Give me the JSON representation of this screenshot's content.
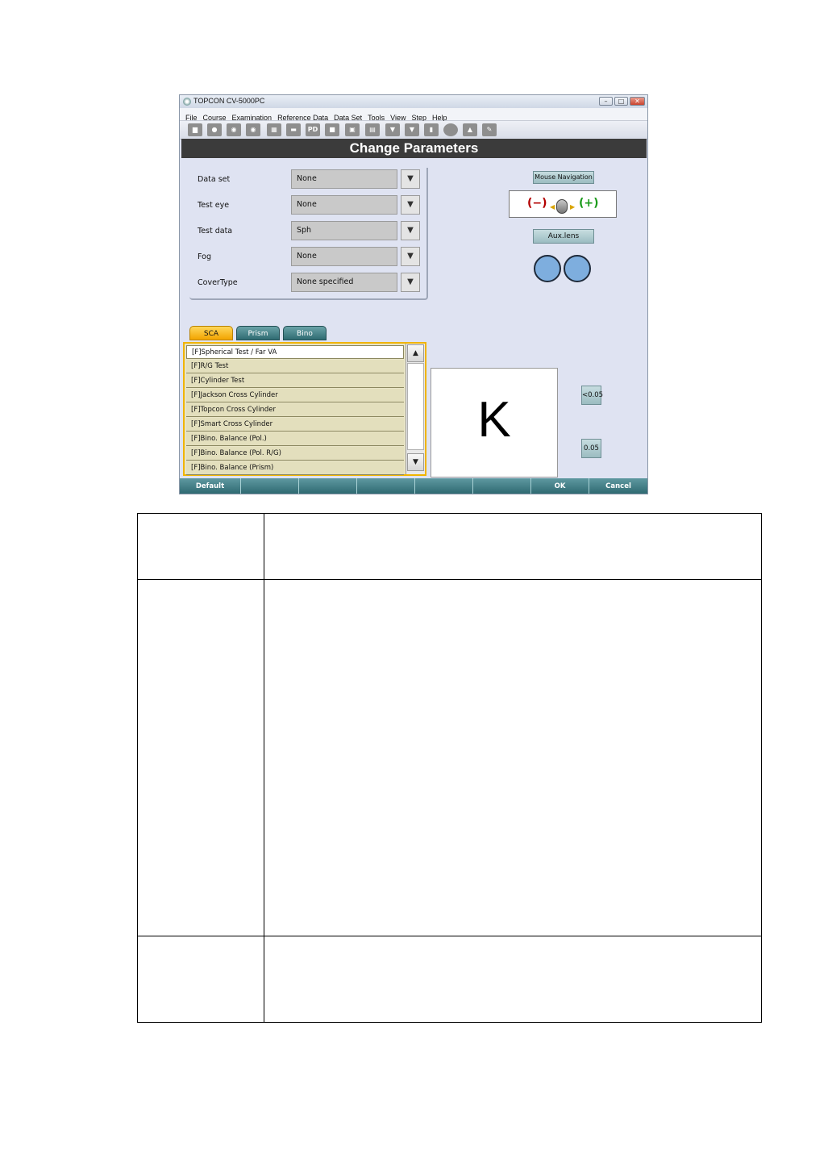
{
  "window": {
    "title": "TOPCON CV-5000PC",
    "controls": {
      "minimize": "–",
      "maximize": "□",
      "close": "✕"
    }
  },
  "menu": [
    "File",
    "Course",
    "Examination",
    "Reference Data",
    "Data Set",
    "Tools",
    "View",
    "Step",
    "Help"
  ],
  "toolbar": {
    "icons": [
      "chart-icon",
      "person-icon",
      "eye-icon",
      "eye-icon",
      "grid-icon",
      "box-icon",
      "pd-icon",
      "screen-icon",
      "monitor-icon",
      "graph-icon",
      "speech-icon",
      "speech-icon",
      "book-icon",
      "circle-icon",
      "person-icon",
      "wrench-icon"
    ],
    "pd_label": "PD"
  },
  "header": {
    "title": "Change Parameters"
  },
  "params": [
    {
      "label": "Data set",
      "value": "None"
    },
    {
      "label": "Test eye",
      "value": "None"
    },
    {
      "label": "Test data",
      "value": "Sph"
    },
    {
      "label": "Fog",
      "value": "None"
    },
    {
      "label": "CoverType",
      "value": "None specified"
    }
  ],
  "dropdown_glyph": "▼",
  "right_panel": {
    "mouse_nav_label": "Mouse Navigation",
    "minus": "(−)",
    "plus": "(+)",
    "aux_lens_label": "Aux.lens",
    "lens_color": "#7eaede"
  },
  "tabs": [
    {
      "label": "SCA",
      "active": true
    },
    {
      "label": "Prism",
      "active": false
    },
    {
      "label": "Bino",
      "active": false
    }
  ],
  "tests": [
    "[F]Spherical Test / Far VA",
    "[F]R/G Test",
    "[F]Cylinder Test",
    "[F]Jackson Cross Cylinder",
    "[F]Topcon Cross Cylinder",
    "[F]Smart Cross Cylinder",
    "[F]Bino. Balance (Pol.)",
    "[F]Bino. Balance (Pol. R/G)",
    "[F]Bino. Balance (Prism)"
  ],
  "scroll": {
    "up": "▲",
    "down": "▼"
  },
  "chart": {
    "letter": "K"
  },
  "va_buttons": [
    "<0.05",
    "0.05"
  ],
  "bottom_bar": [
    "Default",
    "",
    "",
    "",
    "",
    "",
    "OK",
    "Cancel"
  ],
  "colors": {
    "accent_tab": "#f2a400",
    "teal": "#2f6a72",
    "header": "#3b3b3b"
  }
}
